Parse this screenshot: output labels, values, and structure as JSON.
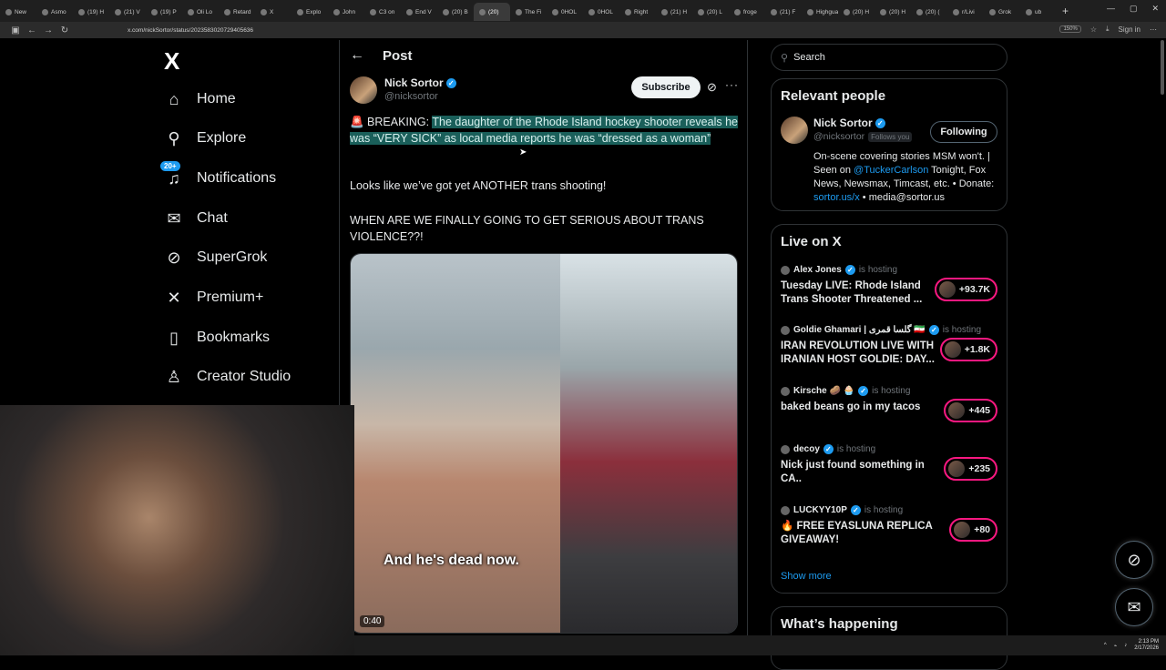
{
  "browser": {
    "tabs": [
      "New",
      "Asmo",
      "(19) H",
      "(21) V",
      "(19) P",
      "Oli Lo",
      "Retard",
      "X",
      "Explo",
      "John",
      "C3 on",
      "End V",
      "(20) B",
      "(20)",
      "The Fi",
      "0HOL",
      "0HOL",
      "Right",
      "(21) H",
      "(20) L",
      "froge",
      "(21) F",
      "Highguar",
      "(20) H",
      "(20) H",
      "(20) (",
      "r/Livi",
      "Grok",
      "ub"
    ],
    "active_tab_index": 13,
    "new_tab": "+",
    "url": "x.com/nickSortor/status/2023583020729405636",
    "zoom": "150%",
    "signin": "Sign in"
  },
  "sidebar": {
    "logo": "X",
    "items": [
      {
        "label": "Home",
        "icon": "home-icon",
        "glyph": "⌂"
      },
      {
        "label": "Explore",
        "icon": "search-icon",
        "glyph": "⚲"
      },
      {
        "label": "Notifications",
        "icon": "bell-icon",
        "glyph": "♫",
        "badge": "20+"
      },
      {
        "label": "Chat",
        "icon": "mail-icon",
        "glyph": "✉"
      },
      {
        "label": "SuperGrok",
        "icon": "grok-icon",
        "glyph": "⊘"
      },
      {
        "label": "Premium+",
        "icon": "x-icon",
        "glyph": "✕"
      },
      {
        "label": "Bookmarks",
        "icon": "bookmark-icon",
        "glyph": "▯"
      },
      {
        "label": "Creator Studio",
        "icon": "creator-icon",
        "glyph": "♙"
      }
    ]
  },
  "post": {
    "header": "Post",
    "author_name": "Nick Sortor",
    "author_handle": "@nicksortor",
    "subscribe_label": "Subscribe",
    "text_lead": "🚨 BREAKING: ",
    "text_highlight": "The daughter of the Rhode Island hockey shooter reveals he was “VERY SICK” as local media reports he was “dressed as a woman”",
    "text_p2": "Looks like we’ve got yet ANOTHER trans shooting!",
    "text_p3": "WHEN ARE WE FINALLY GOING TO GET SERIOUS ABOUT TRANS VIOLENCE??!",
    "video_caption": "And he's dead now.",
    "video_time": "0:40"
  },
  "search": {
    "placeholder": "Search"
  },
  "relevant": {
    "title": "Relevant people",
    "name": "Nick Sortor",
    "handle": "@nicksortor",
    "follows_you": "Follows you",
    "button": "Following",
    "bio_pre": "On-scene covering stories MSM won't. | Seen on ",
    "bio_link1": "@TuckerCarlson",
    "bio_mid": " Tonight, Fox News, Newsmax, Timcast, etc. • Donate: ",
    "bio_link2": "sortor.us/x",
    "bio_post": " • media@sortor.us"
  },
  "live": {
    "title": "Live on X",
    "hosting": "is hosting",
    "items": [
      {
        "host": "Alex Jones",
        "title": "Tuesday LIVE: Rhode Island Trans Shooter Threatened ...",
        "count": "+93.7K"
      },
      {
        "host": "Goldie Ghamari | گلسا قمری 🇮🇷",
        "title": "IRAN REVOLUTION LIVE WITH IRANIAN HOST GOLDIE: DAY...",
        "count": "+1.8K"
      },
      {
        "host": "Kirsche 🥔 🧁",
        "title": "baked beans go in my tacos",
        "count": "+445"
      },
      {
        "host": "decoy",
        "title": "Nick just found something in CA..",
        "count": "+235"
      },
      {
        "host": "LUCKYY10P",
        "title": "🔥 FREE EYASLUNA REPLICA GIVEAWAY!",
        "count": "+80"
      }
    ],
    "show_more": "Show more"
  },
  "whats_happening": {
    "title": "What’s happening"
  },
  "taskbar": {
    "time": "2:13 PM",
    "date": "2/17/2026"
  },
  "colors": {
    "accent": "#1d9bf0",
    "live": "#f91880",
    "highlight": "#1a5f5a"
  }
}
